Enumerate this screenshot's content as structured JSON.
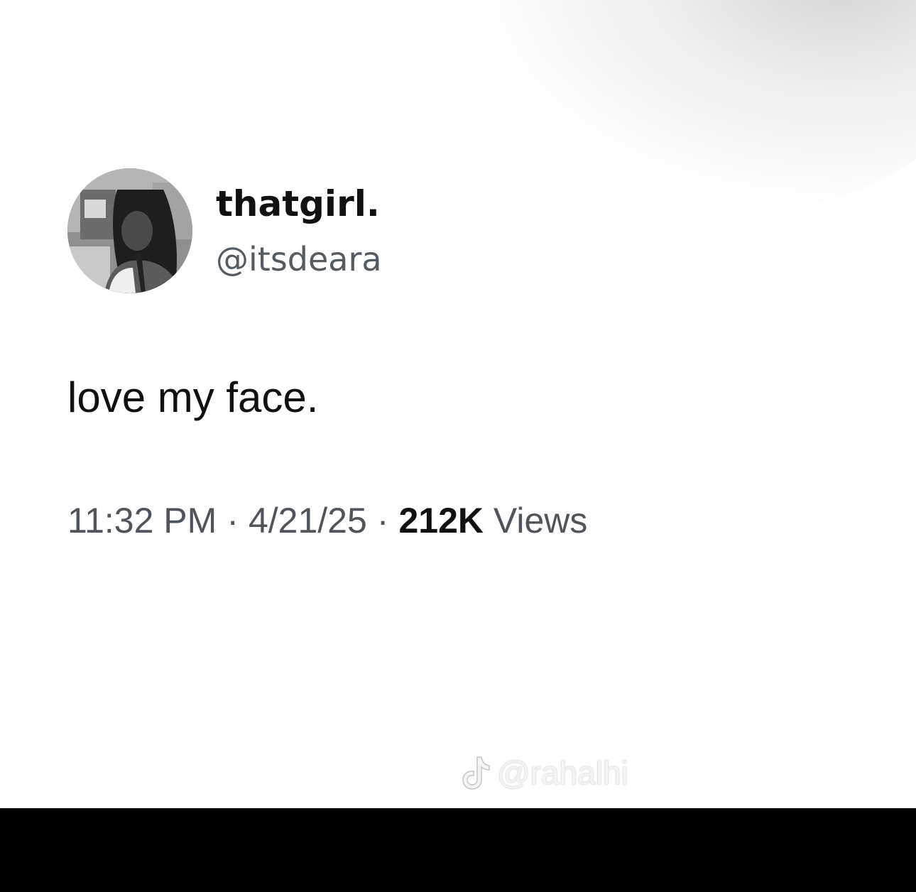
{
  "tweet": {
    "display_name": "thatgirl.",
    "handle": "@itsdeara",
    "text": "love my face.",
    "time": "11:32 PM",
    "separator": "·",
    "date": "4/21/25",
    "views_count": "212K",
    "views_label": "Views"
  },
  "watermark": {
    "logo_icon": "tiktok-icon",
    "handle": "@rahalhi"
  },
  "colors": {
    "background": "#ffffff",
    "primary_text": "#111111",
    "secondary_text": "#545b61",
    "bottom_bar": "#000000"
  }
}
